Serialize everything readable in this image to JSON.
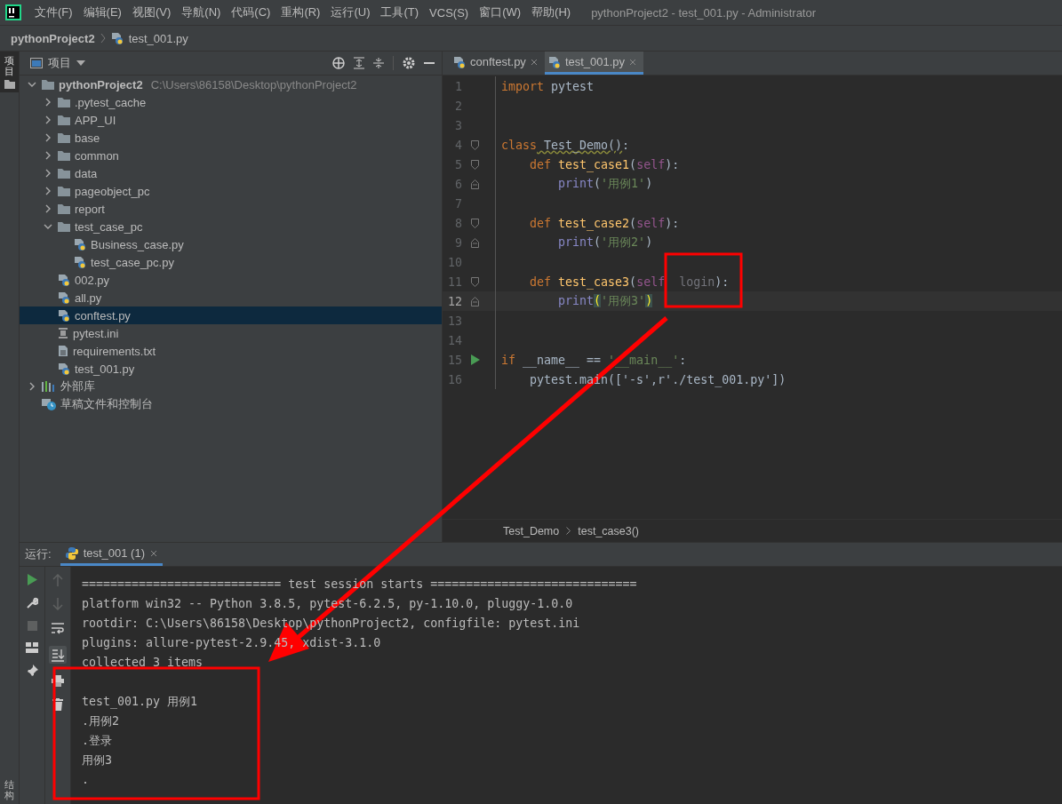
{
  "menu_bar": {
    "items": [
      "文件(F)",
      "编辑(E)",
      "视图(V)",
      "导航(N)",
      "代码(C)",
      "重构(R)",
      "运行(U)",
      "工具(T)",
      "VCS(S)",
      "窗口(W)",
      "帮助(H)"
    ],
    "title": "pythonProject2 - test_001.py - Administrator"
  },
  "nav_bar": {
    "project": "pythonProject2",
    "file": "test_001.py"
  },
  "side_strip": {
    "top_label": "项目",
    "bottom_label": "结构"
  },
  "project_panel": {
    "title": "项目",
    "tree": [
      {
        "label": "pythonProject2",
        "path": "C:\\Users\\86158\\Desktop\\pythonProject2",
        "kind": "folder",
        "expanded": true,
        "selected": false,
        "children": [
          {
            "label": ".pytest_cache",
            "kind": "folder",
            "expanded": false,
            "selected": false
          },
          {
            "label": "APP_UI",
            "kind": "folder",
            "expanded": false,
            "selected": false
          },
          {
            "label": "base",
            "kind": "folder",
            "expanded": false,
            "selected": false
          },
          {
            "label": "common",
            "kind": "folder",
            "expanded": false,
            "selected": false
          },
          {
            "label": "data",
            "kind": "folder",
            "expanded": false,
            "selected": false
          },
          {
            "label": "pageobject_pc",
            "kind": "folder",
            "expanded": false,
            "selected": false
          },
          {
            "label": "report",
            "kind": "folder",
            "expanded": false,
            "selected": false
          },
          {
            "label": "test_case_pc",
            "kind": "folder",
            "expanded": true,
            "selected": false,
            "children": [
              {
                "label": "Business_case.py",
                "kind": "python",
                "selected": false
              },
              {
                "label": "test_case_pc.py",
                "kind": "python",
                "selected": false
              }
            ]
          },
          {
            "label": "002.py",
            "kind": "python",
            "selected": false
          },
          {
            "label": "all.py",
            "kind": "python",
            "selected": false
          },
          {
            "label": "conftest.py",
            "kind": "python",
            "selected": true
          },
          {
            "label": "pytest.ini",
            "kind": "ini",
            "selected": false
          },
          {
            "label": "requirements.txt",
            "kind": "text",
            "selected": false
          },
          {
            "label": "test_001.py",
            "kind": "python",
            "selected": false
          }
        ]
      },
      {
        "label": "外部库",
        "kind": "library",
        "expanded": false,
        "selected": false
      },
      {
        "label": "草稿文件和控制台",
        "kind": "scratch",
        "selected": false
      }
    ]
  },
  "editor": {
    "tabs": [
      {
        "label": "conftest.py",
        "selected": false
      },
      {
        "label": "test_001.py",
        "selected": true
      }
    ],
    "lines": [
      {
        "number": "1",
        "current": false,
        "kind": "plain",
        "tokens": [
          {
            "kind": "keyword",
            "text": "import"
          },
          {
            "kind": "plain",
            "text": " pytest"
          }
        ]
      },
      {
        "number": "2",
        "current": false,
        "kind": "plain"
      },
      {
        "number": "3",
        "current": false,
        "kind": "plain"
      },
      {
        "number": "4",
        "current": false,
        "kind": "fold-start",
        "tokens": [
          {
            "kind": "keyword",
            "text": "class"
          },
          {
            "kind": "warn",
            "text": " Test_Demo()"
          },
          {
            "kind": "plain",
            "text": ":"
          }
        ]
      },
      {
        "number": "5",
        "current": false,
        "kind": "fold-start",
        "tokens": [
          {
            "kind": "keyword",
            "text": "    def"
          },
          {
            "kind": "func",
            "text": " test_case1"
          },
          {
            "kind": "plain",
            "text": "("
          },
          {
            "kind": "self",
            "text": "self"
          },
          {
            "kind": "plain",
            "text": "):"
          }
        ]
      },
      {
        "number": "6",
        "current": false,
        "kind": "fold-end",
        "tokens": [
          {
            "kind": "builtin",
            "text": "        print"
          },
          {
            "kind": "plain",
            "text": "("
          },
          {
            "kind": "string",
            "text": "'用例1'"
          },
          {
            "kind": "plain",
            "text": ")"
          }
        ]
      },
      {
        "number": "7",
        "current": false,
        "kind": "plain"
      },
      {
        "number": "8",
        "current": false,
        "kind": "fold-start",
        "tokens": [
          {
            "kind": "keyword",
            "text": "    def"
          },
          {
            "kind": "func",
            "text": " test_case2"
          },
          {
            "kind": "plain",
            "text": "("
          },
          {
            "kind": "self",
            "text": "self"
          },
          {
            "kind": "plain",
            "text": "):"
          }
        ]
      },
      {
        "number": "9",
        "current": false,
        "kind": "fold-end",
        "tokens": [
          {
            "kind": "builtin",
            "text": "        print"
          },
          {
            "kind": "plain",
            "text": "("
          },
          {
            "kind": "string",
            "text": "'用例2'"
          },
          {
            "kind": "plain",
            "text": ")"
          }
        ]
      },
      {
        "number": "10",
        "current": false,
        "kind": "plain"
      },
      {
        "number": "11",
        "current": false,
        "kind": "fold-start",
        "tokens": [
          {
            "kind": "keyword",
            "text": "    def"
          },
          {
            "kind": "func",
            "text": " test_case3"
          },
          {
            "kind": "plain",
            "text": "("
          },
          {
            "kind": "self",
            "text": "self"
          },
          {
            "kind": "param",
            "text": "  login"
          },
          {
            "kind": "plain",
            "text": "):"
          }
        ]
      },
      {
        "number": "12",
        "current": true,
        "kind": "fold-end",
        "tokens": [
          {
            "kind": "builtin",
            "text": "        print"
          },
          {
            "kind": "brace",
            "text": "("
          },
          {
            "kind": "string",
            "text": "'用例3'"
          },
          {
            "kind": "brace",
            "text": ")"
          }
        ]
      },
      {
        "number": "13",
        "current": false,
        "kind": "plain"
      },
      {
        "number": "14",
        "current": false,
        "kind": "plain"
      },
      {
        "number": "15",
        "current": false,
        "kind": "run",
        "tokens": [
          {
            "kind": "keyword",
            "text": "if"
          },
          {
            "kind": "plain",
            "text": " __name__ == "
          },
          {
            "kind": "string",
            "text": "'__main__'"
          },
          {
            "kind": "plain",
            "text": ":"
          }
        ]
      },
      {
        "number": "16",
        "current": false,
        "kind": "plain",
        "tokens": [
          {
            "kind": "plain",
            "text": "    pytest.main(['-s',r'./test_001.py'])"
          }
        ]
      }
    ],
    "breadcrumbs": [
      "Test_Demo",
      "test_case3()"
    ]
  },
  "run_panel": {
    "label": "运行:",
    "tab": "test_001 (1)",
    "console": [
      {
        "kind": "line",
        "text": "============================ test session starts ============================="
      },
      {
        "kind": "line",
        "text": "platform win32 -- Python 3.8.5, pytest-6.2.5, py-1.10.0, pluggy-1.0.0"
      },
      {
        "kind": "line",
        "text": "rootdir: C:\\Users\\86158\\Desktop\\pythonProject2, configfile: pytest.ini"
      },
      {
        "kind": "line",
        "text": "plugins: allure-pytest-2.9.45, xdist-3.1.0"
      },
      {
        "kind": "line",
        "text": "collected 3 items"
      },
      {
        "kind": "blank"
      },
      {
        "kind": "line",
        "text": "test_001.py 用例1"
      },
      {
        "kind": "line",
        "text": ".用例2"
      },
      {
        "kind": "line",
        "text": ".登录"
      },
      {
        "kind": "line",
        "text": "用例3"
      },
      {
        "kind": "line",
        "text": "."
      }
    ]
  },
  "annotations": [
    {
      "kind": "box"
    },
    {
      "kind": "box"
    },
    {
      "kind": "arrow"
    }
  ]
}
